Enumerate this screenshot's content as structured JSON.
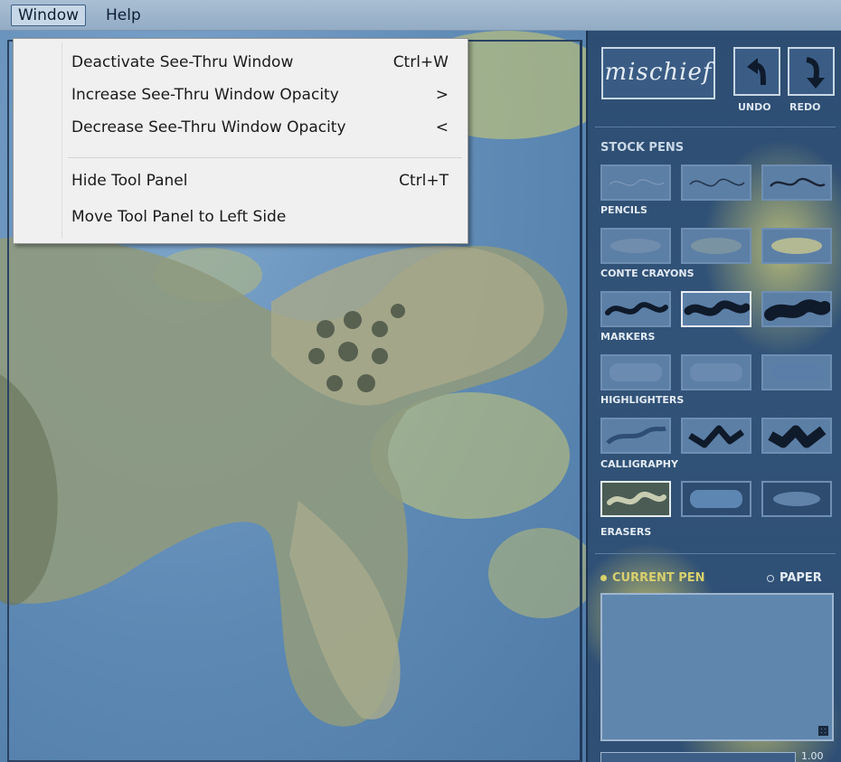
{
  "menubar": {
    "items": [
      {
        "label": "Window",
        "active": true
      },
      {
        "label": "Help",
        "active": false
      }
    ]
  },
  "window_menu": {
    "items": [
      {
        "label": "Deactivate See-Thru Window",
        "shortcut": "Ctrl+W"
      },
      {
        "label": "Increase See-Thru Window Opacity",
        "shortcut": ">"
      },
      {
        "label": "Decrease See-Thru Window Opacity",
        "shortcut": "<"
      },
      {
        "label": "Hide Tool Panel",
        "shortcut": "Ctrl+T"
      },
      {
        "label": "Move Tool Panel to Left Side",
        "shortcut": ""
      }
    ]
  },
  "tool_panel": {
    "logo": "mischief",
    "undo_label": "UNDO",
    "redo_label": "REDO",
    "stock_pens_title": "STOCK PENS",
    "groups": [
      "PENCILS",
      "CONTE CRAYONS",
      "MARKERS",
      "HIGHLIGHTERS",
      "CALLIGRAPHY",
      "ERASERS"
    ],
    "current_pen_label": "CURRENT PEN",
    "paper_label": "PAPER",
    "size_value": "1.00"
  },
  "colors": {
    "panel_bg": "#2f4f74",
    "accent_yellow": "#d8d06c",
    "menu_bg": "#f0f0f0"
  }
}
